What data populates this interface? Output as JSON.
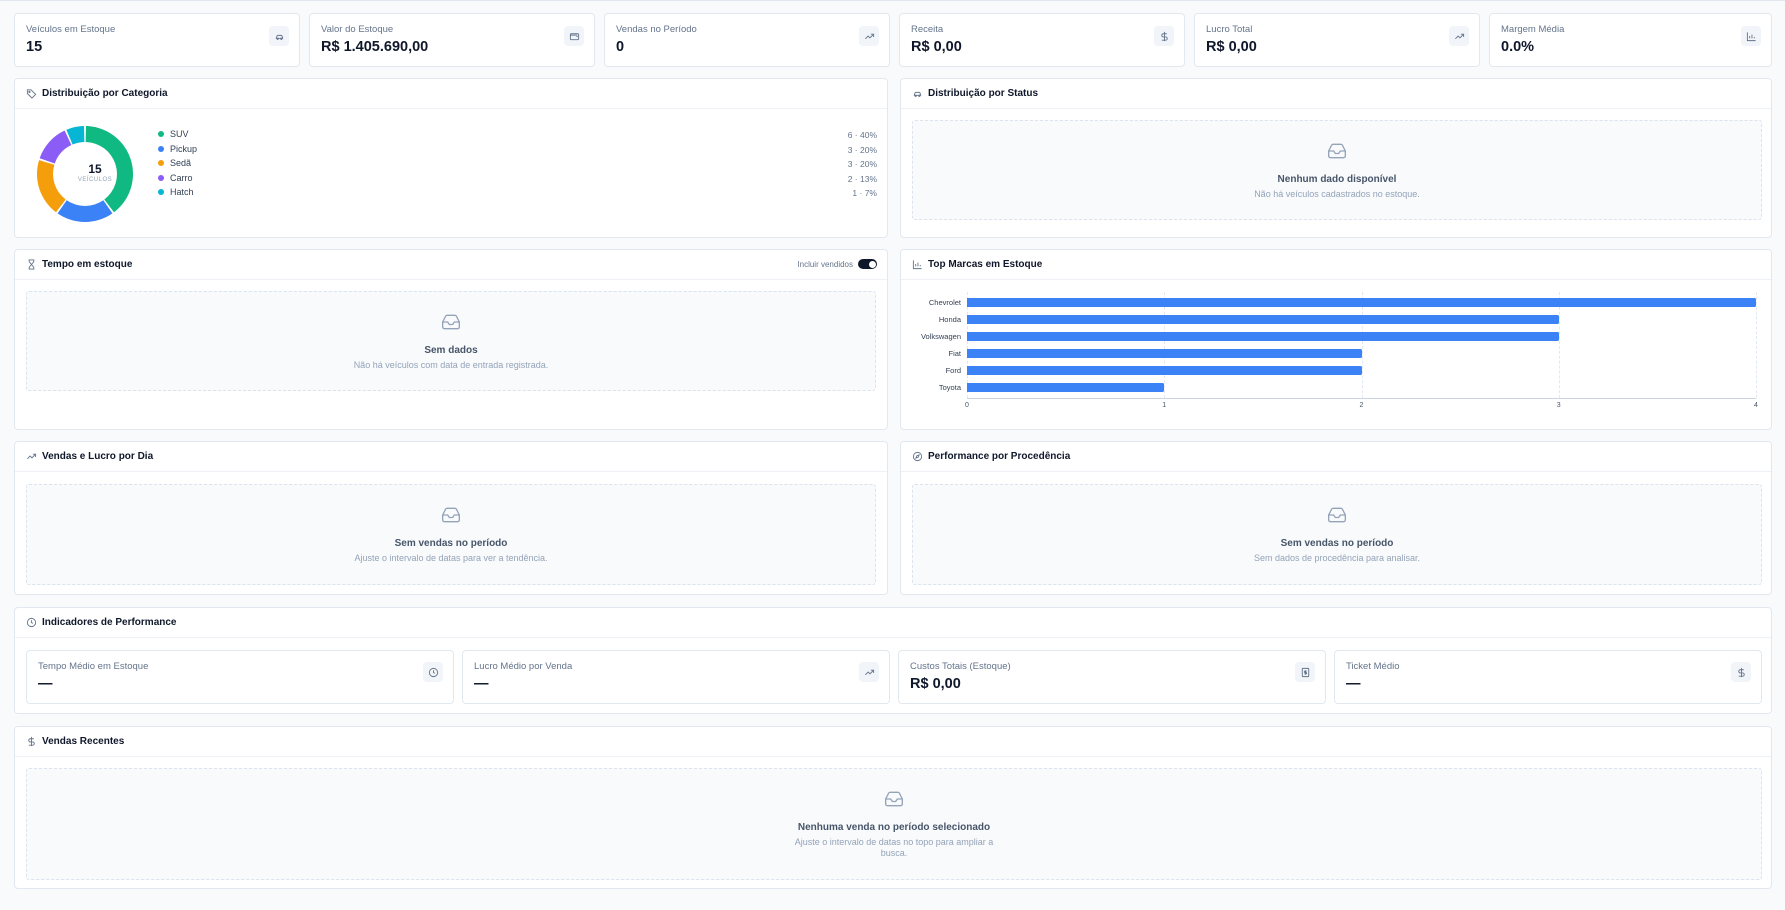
{
  "kpis": [
    {
      "label": "Veículos em Estoque",
      "value": "15",
      "icon": "car-icon"
    },
    {
      "label": "Valor do Estoque",
      "value": "R$ 1.405.690,00",
      "icon": "wallet-icon"
    },
    {
      "label": "Vendas no Período",
      "value": "0",
      "icon": "trending-up-icon"
    },
    {
      "label": "Receita",
      "value": "R$ 0,00",
      "icon": "dollar-icon"
    },
    {
      "label": "Lucro Total",
      "value": "R$ 0,00",
      "icon": "trending-up-icon"
    },
    {
      "label": "Margem Média",
      "value": "0.0%",
      "icon": "bar-chart-icon"
    }
  ],
  "categoria": {
    "title": "Distribuição por Categoria",
    "total": "15",
    "total_label": "VEÍCULOS",
    "items": [
      {
        "name": "SUV",
        "value": 6,
        "label": "6 · 40%",
        "color": "#10b981"
      },
      {
        "name": "Pickup",
        "value": 3,
        "label": "3 · 20%",
        "color": "#3b82f6"
      },
      {
        "name": "Sedã",
        "value": 3,
        "label": "3 · 20%",
        "color": "#f59e0b"
      },
      {
        "name": "Carro",
        "value": 2,
        "label": "2 · 13%",
        "color": "#8b5cf6"
      },
      {
        "name": "Hatch",
        "value": 1,
        "label": "1 · 7%",
        "color": "#06b6d4"
      }
    ]
  },
  "status": {
    "title": "Distribuição por Status",
    "empty_title": "Nenhum dado disponível",
    "empty_sub": "Não há veículos cadastrados no estoque."
  },
  "tempo": {
    "title": "Tempo em estoque",
    "toggle_label": "Incluir vendidos",
    "empty_title": "Sem dados",
    "empty_sub": "Não há veículos com data de entrada registrada."
  },
  "marcas": {
    "title": "Top Marcas em Estoque"
  },
  "vendas_lucro": {
    "title": "Vendas e Lucro por Dia",
    "empty_title": "Sem vendas no período",
    "empty_sub": "Ajuste o intervalo de datas para ver a tendência."
  },
  "procedencia": {
    "title": "Performance por Procedência",
    "empty_title": "Sem vendas no período",
    "empty_sub": "Sem dados de procedência para analisar."
  },
  "indicadores": {
    "title": "Indicadores de Performance",
    "items": [
      {
        "label": "Tempo Médio em Estoque",
        "value": "—",
        "icon": "clock-icon"
      },
      {
        "label": "Lucro Médio por Venda",
        "value": "—",
        "icon": "trending-up-icon"
      },
      {
        "label": "Custos Totais (Estoque)",
        "value": "R$ 0,00",
        "icon": "receipt-icon"
      },
      {
        "label": "Ticket Médio",
        "value": "—",
        "icon": "dollar-icon"
      }
    ]
  },
  "recentes": {
    "title": "Vendas Recentes",
    "empty_title": "Nenhuma venda no período selecionado",
    "empty_sub": "Ajuste o intervalo de datas no topo para ampliar a busca."
  },
  "chart_data": {
    "type": "bar",
    "orientation": "horizontal",
    "categories": [
      "Chevrolet",
      "Honda",
      "Volkswagen",
      "Fiat",
      "Ford",
      "Toyota"
    ],
    "values": [
      4,
      3,
      3,
      2,
      2,
      1
    ],
    "xlim": [
      0,
      4
    ],
    "xticks": [
      0,
      1,
      2,
      3,
      4
    ],
    "color": "#3b82f6",
    "grid": true
  }
}
